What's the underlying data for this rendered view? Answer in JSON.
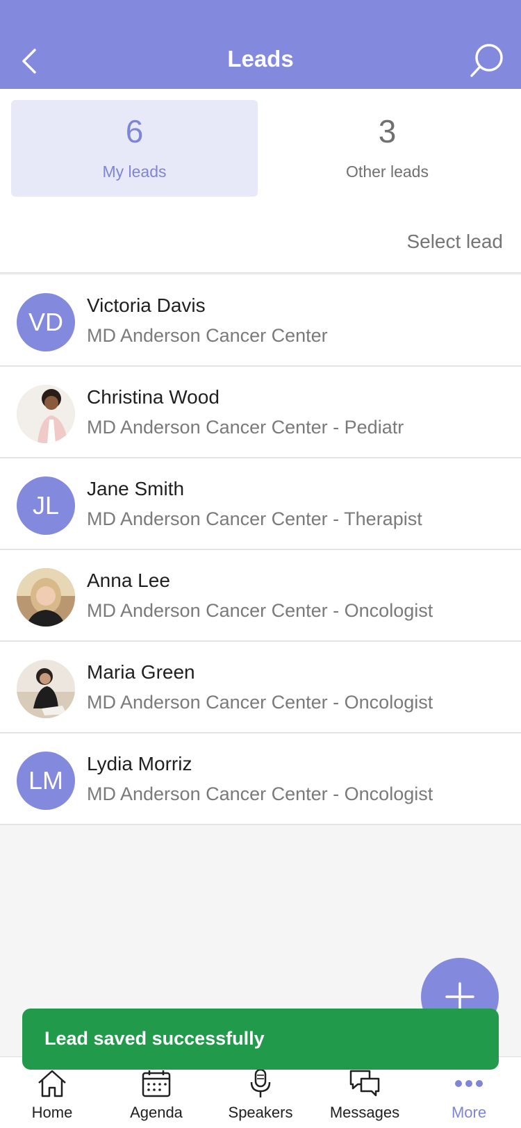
{
  "header": {
    "title": "Leads",
    "back_icon": "chevron-left-icon",
    "search_icon": "search-icon"
  },
  "tabs": {
    "my": {
      "count": "6",
      "label": "My leads"
    },
    "other": {
      "count": "3",
      "label": "Other leads"
    }
  },
  "select_lead": "Select lead",
  "leads": [
    {
      "name": "Victoria Davis",
      "org": "MD Anderson Cancer Center",
      "initials": "VD"
    },
    {
      "name": "Christina Wood",
      "org": "MD Anderson Cancer Center - Pediatr",
      "initials": ""
    },
    {
      "name": "Jane Smith",
      "org": "MD Anderson Cancer Center - Therapist",
      "initials": "JL"
    },
    {
      "name": "Anna Lee",
      "org": "MD Anderson Cancer Center - Oncologist",
      "initials": ""
    },
    {
      "name": "Maria Green",
      "org": "MD Anderson Cancer Center - Oncologist",
      "initials": ""
    },
    {
      "name": "Lydia Morriz",
      "org": "MD Anderson Cancer Center - Oncologist",
      "initials": "LM"
    }
  ],
  "toast": "Lead saved successfully",
  "nav": {
    "home": "Home",
    "agenda": "Agenda",
    "speakers": "Speakers",
    "messages": "Messages",
    "more": "More"
  },
  "colors": {
    "accent": "#8389dc",
    "toast": "#229a4b"
  }
}
